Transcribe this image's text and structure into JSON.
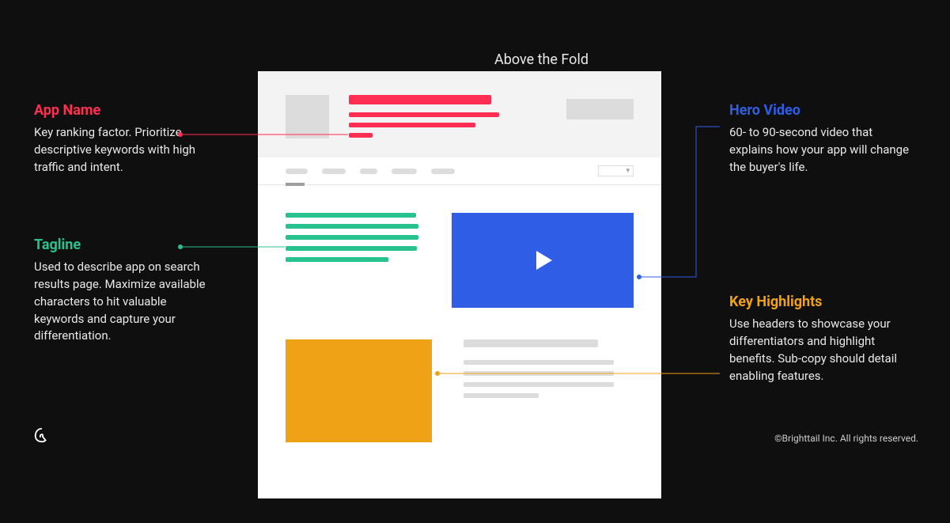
{
  "section_title": "Above the Fold",
  "annotations": {
    "app_name": {
      "heading": "App Name",
      "body": "Key ranking factor. Prioritize descriptive keywords with high traffic and intent.",
      "color": "#ff2e52"
    },
    "tagline": {
      "heading": "Tagline",
      "body": "Used to describe app on search results page. Maximize available characters to hit valuable keywords and capture your differentiation.",
      "color": "#27c28e"
    },
    "hero_video": {
      "heading": "Hero Video",
      "body": "60- to 90-second video that explains how your app will change the buyer's life.",
      "color": "#2f5de6"
    },
    "key_highlights": {
      "heading": "Key Highlights",
      "body": "Use headers to showcase your differentiators and highlight benefits. Sub-copy should detail enabling features.",
      "color": "#f0a216"
    }
  },
  "mockup": {
    "icon": "app-icon",
    "cta": "cta-button",
    "tabs": 5,
    "tagline_lines": 5,
    "video_icon": "play-icon",
    "highlight_text_lines": 4
  },
  "logo_name": "brighttail-logo",
  "copyright": "©Brighttail Inc. All rights reserved."
}
